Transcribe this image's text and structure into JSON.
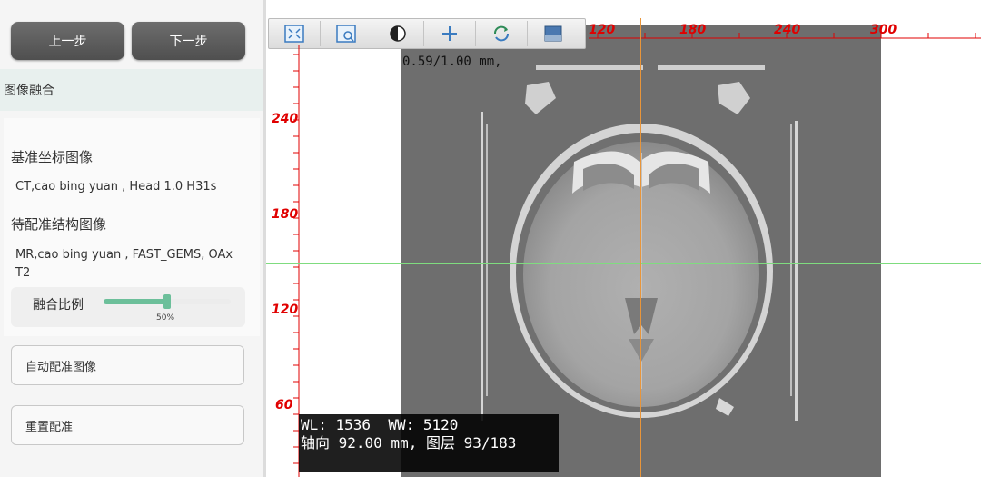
{
  "nav": {
    "prev_label": "上一步",
    "next_label": "下一步"
  },
  "section": {
    "title": "图像融合"
  },
  "config": {
    "reference_label": "基准坐标图像",
    "reference_value": "CT,cao bing yuan , Head 1.0 H31s",
    "moving_label": "待配准结构图像",
    "moving_value": "MR,cao bing yuan , FAST_GEMS, OAx T2",
    "ratio_label": "融合比例",
    "ratio_value": 50,
    "ratio_text": "50%"
  },
  "actions": {
    "auto_register_label": "自动配准图像",
    "reset_label": "重置配准"
  },
  "toolbar": {
    "tools": [
      {
        "icon": "fit-window-icon"
      },
      {
        "icon": "zoom-box-icon"
      },
      {
        "icon": "contrast-icon"
      },
      {
        "icon": "crosshair-icon"
      },
      {
        "icon": "rotate-icon"
      },
      {
        "icon": "overlay-icon"
      }
    ]
  },
  "rulers": {
    "horizontal_labels": [
      "120",
      "180",
      "240",
      "300"
    ],
    "vertical_labels": [
      "240",
      "180",
      "120",
      "60"
    ],
    "tick_color": "#e00000"
  },
  "overlay": {
    "pixel_info": "0.59/1.00 mm,",
    "wl_text": "WL: 1536  WW: 5120",
    "slice_text": "轴向 92.00 mm, 图层 93/183"
  },
  "crosshair": {
    "h_color": "#7fdc7f",
    "v_color": "#e8953a"
  },
  "colors": {
    "accent": "#6cbf9a",
    "button_dark": "#5a5a5a"
  }
}
